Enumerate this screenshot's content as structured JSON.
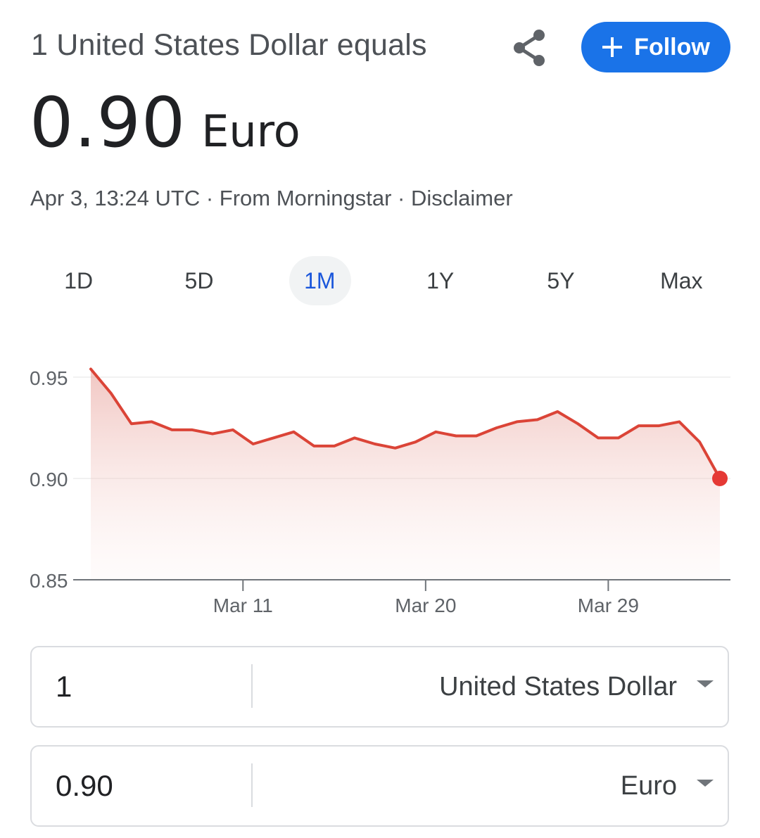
{
  "header": {
    "title": "1 United States Dollar equals",
    "follow_label": "Follow",
    "share_icon": "share-icon",
    "accent_color": "#1a73e8"
  },
  "rate": {
    "value": "0.90",
    "unit": "Euro"
  },
  "meta": {
    "timestamp": "Apr 3, 13:24 UTC",
    "separator": "·",
    "source": "From Morningstar",
    "disclaimer": "Disclaimer"
  },
  "range_tabs": [
    {
      "label": "1D",
      "active": false
    },
    {
      "label": "5D",
      "active": false
    },
    {
      "label": "1M",
      "active": true
    },
    {
      "label": "1Y",
      "active": false
    },
    {
      "label": "5Y",
      "active": false
    },
    {
      "label": "Max",
      "active": false
    }
  ],
  "chart_data": {
    "type": "area",
    "ylim": [
      0.85,
      0.955
    ],
    "yticks": [
      "0.95",
      "0.90",
      "0.85"
    ],
    "ytick_values": [
      0.95,
      0.9,
      0.85
    ],
    "x_tick_labels": [
      "Mar 11",
      "Mar 20",
      "Mar 29"
    ],
    "x_tick_values": [
      7.5,
      16.5,
      25.5
    ],
    "x_range": [
      0,
      31
    ],
    "series": [
      {
        "color": "#db4437",
        "x": [
          0,
          1,
          2,
          3,
          4,
          5,
          6,
          7,
          8,
          9,
          10,
          11,
          12,
          13,
          14,
          15,
          16,
          17,
          18,
          19,
          20,
          21,
          22,
          23,
          24,
          25,
          26,
          27,
          28,
          29,
          30,
          31
        ],
        "values": [
          0.954,
          0.942,
          0.927,
          0.928,
          0.924,
          0.924,
          0.922,
          0.924,
          0.917,
          0.92,
          0.923,
          0.916,
          0.916,
          0.92,
          0.917,
          0.915,
          0.918,
          0.923,
          0.921,
          0.921,
          0.925,
          0.928,
          0.929,
          0.933,
          0.927,
          0.92,
          0.92,
          0.926,
          0.926,
          0.928,
          0.918,
          0.9
        ]
      }
    ],
    "grid": true,
    "last_point_marker": true
  },
  "converter": {
    "from": {
      "value": "1",
      "currency": "United States Dollar"
    },
    "to": {
      "value": "0.90",
      "currency": "Euro"
    }
  }
}
